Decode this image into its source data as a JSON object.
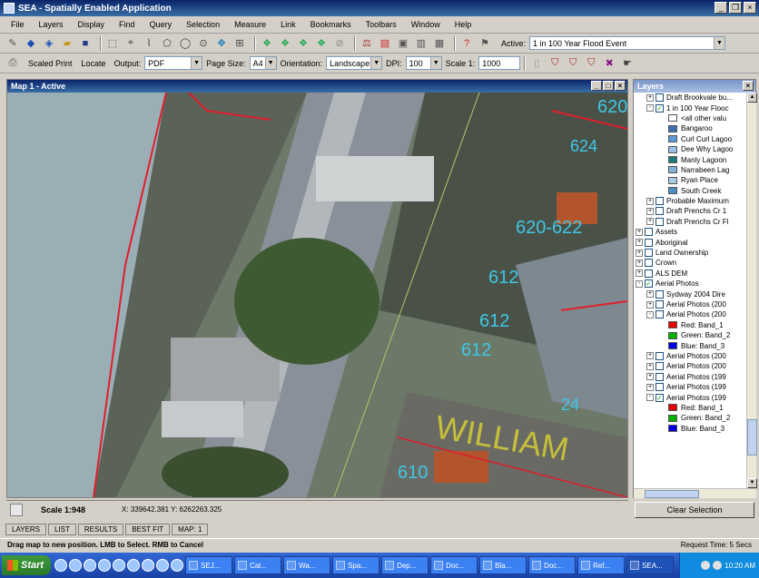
{
  "window": {
    "title": "SEA - Spatially Enabled Application",
    "buttons": [
      "_",
      "❐",
      "×"
    ]
  },
  "menu": [
    "File",
    "Layers",
    "Display",
    "Find",
    "Query",
    "Selection",
    "Measure",
    "Link",
    "Bookmarks",
    "Toolbars",
    "Window",
    "Help"
  ],
  "toolbar1": {
    "active_label": "Active:",
    "active_value": "1 in 100 Year Flood Event"
  },
  "toolbar2": {
    "scaled_print": "Scaled Print",
    "locate": "Locate",
    "output_label": "Output:",
    "output_value": "PDF",
    "page_size_label": "Page Size:",
    "page_size_value": "A4",
    "orientation_label": "Orientation:",
    "orientation_value": "Landscape",
    "dpi_label": "DPI:",
    "dpi_value": "100",
    "scale_label": "Scale 1:",
    "scale_value": "1000"
  },
  "map": {
    "title": "Map 1 - Active",
    "labels": [
      "620",
      "624",
      "620-622",
      "612",
      "612",
      "612",
      "24",
      "610",
      "WILLIAM"
    ],
    "scale_text": "Scale 1:948",
    "coords": "X: 339642.381  Y: 6262263.325"
  },
  "layers": {
    "title": "Layers",
    "clear_selection": "Clear Selection",
    "rows": [
      {
        "indent": 1,
        "expander": "+",
        "check": false,
        "label": "Draft Brookvale bu..."
      },
      {
        "indent": 1,
        "expander": "-",
        "check": true,
        "label": "1 in 100 Year Flooc"
      },
      {
        "indent": 3,
        "swatch": "#ffffff",
        "label": "<all other valu"
      },
      {
        "indent": 3,
        "swatch": "#3a6fb0",
        "label": "Bangaroo"
      },
      {
        "indent": 3,
        "swatch": "#5b9bd5",
        "label": "Curl Curl Lagoo"
      },
      {
        "indent": 3,
        "swatch": "#9bc2e6",
        "label": "Dee Why Lagoo"
      },
      {
        "indent": 3,
        "swatch": "#1f7a7a",
        "label": "Manly Lagoon"
      },
      {
        "indent": 3,
        "swatch": "#7fb3d5",
        "label": "Narrabeen Lag"
      },
      {
        "indent": 3,
        "swatch": "#a9cce3",
        "label": "Ryan Place"
      },
      {
        "indent": 3,
        "swatch": "#4a8fc2",
        "label": "South Creek"
      },
      {
        "indent": 1,
        "expander": "+",
        "check": false,
        "label": "Probable Maximum"
      },
      {
        "indent": 1,
        "expander": "+",
        "check": false,
        "label": "Draft Prenchs Cr 1"
      },
      {
        "indent": 1,
        "expander": "+",
        "check": false,
        "label": "Draft Prenchs Cr Fl"
      },
      {
        "indent": 0,
        "expander": "+",
        "check": false,
        "label": "Assets"
      },
      {
        "indent": 0,
        "expander": "+",
        "check": false,
        "label": "Aboriginal"
      },
      {
        "indent": 0,
        "expander": "+",
        "check": false,
        "label": "Land Ownership"
      },
      {
        "indent": 0,
        "expander": "+",
        "check": false,
        "label": "Crown"
      },
      {
        "indent": 0,
        "expander": "+",
        "check": false,
        "label": "ALS DEM"
      },
      {
        "indent": 0,
        "expander": "-",
        "check": true,
        "label": "Aerial Photos"
      },
      {
        "indent": 1,
        "expander": "+",
        "check": false,
        "label": "Sydway 2004 Dire"
      },
      {
        "indent": 1,
        "expander": "+",
        "check": false,
        "label": "Aerial Photos (200"
      },
      {
        "indent": 1,
        "expander": "-",
        "check": false,
        "label": "Aerial Photos (200"
      },
      {
        "indent": 3,
        "swatch": "#e00000",
        "label": "Red:   Band_1"
      },
      {
        "indent": 3,
        "swatch": "#00b000",
        "label": "Green: Band_2"
      },
      {
        "indent": 3,
        "swatch": "#0000e0",
        "label": "Blue:  Band_3"
      },
      {
        "indent": 1,
        "expander": "+",
        "check": false,
        "label": "Aerial Photos (200"
      },
      {
        "indent": 1,
        "expander": "+",
        "check": false,
        "label": "Aerial Photos (200"
      },
      {
        "indent": 1,
        "expander": "+",
        "check": false,
        "label": "Aerial Photos (199"
      },
      {
        "indent": 1,
        "expander": "+",
        "check": false,
        "label": "Aerial Photos (199"
      },
      {
        "indent": 1,
        "expander": "-",
        "check": true,
        "label": "Aerial Photos (199"
      },
      {
        "indent": 3,
        "swatch": "#e00000",
        "label": "Red:   Band_1"
      },
      {
        "indent": 3,
        "swatch": "#00b000",
        "label": "Green: Band_2"
      },
      {
        "indent": 3,
        "swatch": "#0000e0",
        "label": "Blue:  Band_3"
      }
    ]
  },
  "tabs": [
    "LAYERS",
    "LIST",
    "RESULTS",
    "BEST FIT",
    "MAP:  1"
  ],
  "status": {
    "hint": "Drag map to new position. LMB to Select. RMB to Cancel",
    "request_time": "Request Time: 5 Secs"
  },
  "taskbar": {
    "start": "Start",
    "tasks": [
      "SEJ...",
      "Cal...",
      "Wa...",
      "Spa...",
      "Dep...",
      "Doc...",
      "Bla...",
      "Doc...",
      "Ref...",
      "SEA..."
    ],
    "clock": "10:20 AM"
  }
}
